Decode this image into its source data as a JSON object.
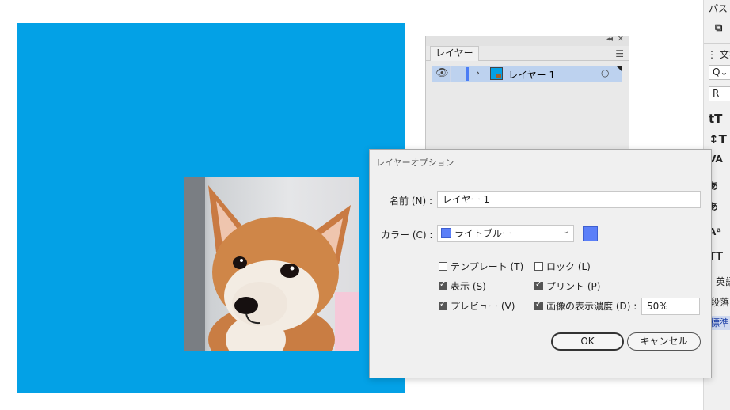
{
  "canvas": {
    "background": "#ffffff",
    "artboard_color": "#03a1e6"
  },
  "layers_panel": {
    "tab": "レイヤー",
    "collapse_icon": "double-chevron-left-icon",
    "close_icon": "close-icon",
    "menu_icon": "panel-menu-icon",
    "rows": [
      {
        "name": "レイヤー 1",
        "visible": true,
        "expanded": false,
        "target": "○"
      }
    ]
  },
  "dialog": {
    "title": "レイヤーオプション",
    "name_label": "名前 (N) :",
    "name_value": "レイヤー 1",
    "color_label": "カラー (C) :",
    "color_value": "ライトブルー",
    "color_hex": "#5b7ff8",
    "checkboxes": {
      "template": {
        "label": "テンプレート (T)",
        "checked": false
      },
      "lock": {
        "label": "ロック (L)",
        "checked": false
      },
      "show": {
        "label": "表示 (S)",
        "checked": true
      },
      "print": {
        "label": "プリント (P)",
        "checked": true
      },
      "preview": {
        "label": "プレビュー (V)",
        "checked": true
      },
      "dim": {
        "label": "画像の表示濃度 (D) :",
        "checked": true
      }
    },
    "dim_value": "50%",
    "ok_label": "OK",
    "cancel_label": "キャンセル"
  },
  "right_panel": {
    "path_label": "パス",
    "pathfinder_icon": "pathfinder-icon",
    "char_label": "文字",
    "search_label": "Q⌄",
    "font_style": "R",
    "size_icon": "tT",
    "leading_icon": "↕T",
    "tracking_icon": "VA",
    "kerning_icon": "あ",
    "kerning2_icon": "あ",
    "baseline_icon": "Aª",
    "caps_icon": "TT",
    "language": "英語",
    "paragraph": "段落",
    "standard": "標準"
  }
}
